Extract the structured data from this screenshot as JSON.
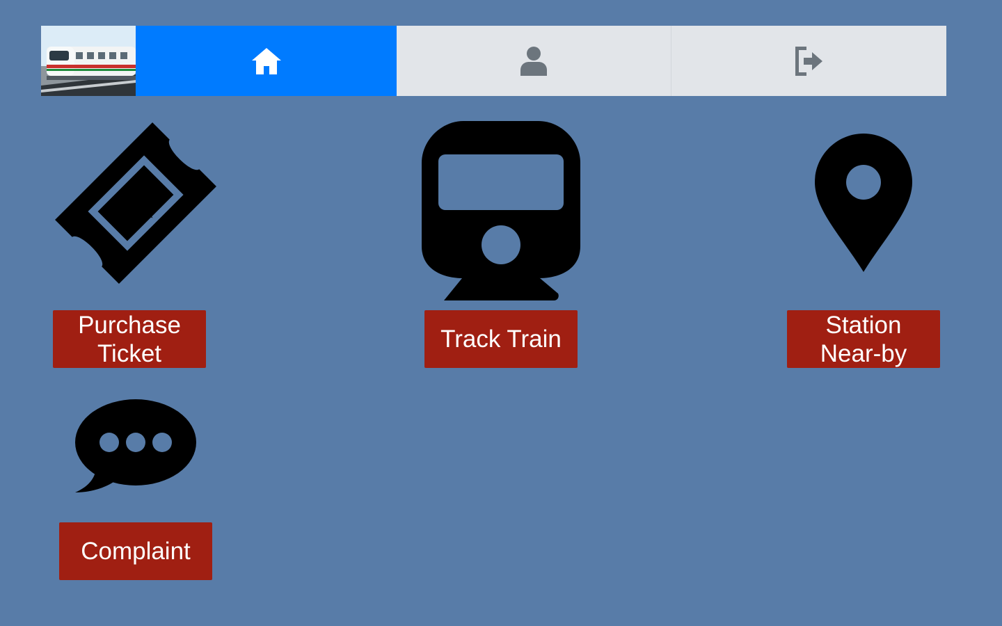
{
  "navbar": {
    "logo": "metro-train-logo",
    "tabs": [
      {
        "icon": "home-icon",
        "active": true
      },
      {
        "icon": "user-icon",
        "active": false
      },
      {
        "icon": "logout-icon",
        "active": false
      }
    ],
    "colors": {
      "active_tab": "#007bff",
      "inactive_tab": "#e2e5e9",
      "inactive_icon": "#6c757d"
    }
  },
  "features": [
    {
      "icon": "ticket-icon",
      "label": "Purchase Ticket"
    },
    {
      "icon": "train-icon",
      "label": "Track Train"
    },
    {
      "icon": "map-pin-icon",
      "label": "Station Near-by"
    },
    {
      "icon": "comment-bubble-icon",
      "label": "Complaint"
    }
  ],
  "colors": {
    "background": "#587ca8",
    "button": "#a01f12",
    "button_text": "#ffffff",
    "icon": "#000000"
  }
}
